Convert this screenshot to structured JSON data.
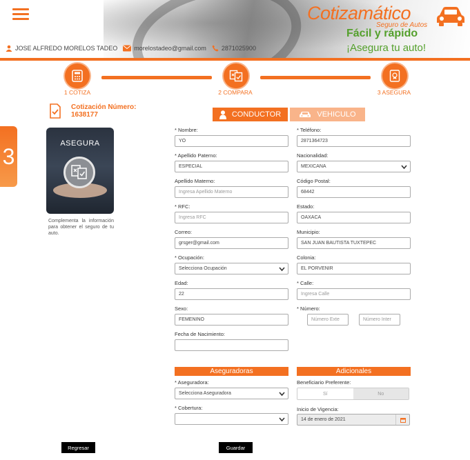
{
  "header": {
    "brand_title": "Cotizamático",
    "brand_subtitle": "Seguro de Autos",
    "slogan_primary": "Fácil y rápido",
    "slogan_secondary": "¡Asegura tu auto!",
    "user_name": "JOSE ALFREDO MORELOS TADEO",
    "user_email": "morelostadeo@gmail.com",
    "user_phone": "2871025900"
  },
  "steps": [
    {
      "label": "1 COTIZA",
      "icon": "calculator-icon"
    },
    {
      "label": "2 COMPARA",
      "icon": "compare-documents-icon"
    },
    {
      "label": "3 ASEGURA",
      "icon": "certificate-icon"
    }
  ],
  "sidebar": {
    "step_number": "3",
    "quote_label": "Cotización Número:",
    "quote_number": "1638177",
    "card_title": "ASEGURA",
    "card_text": "Complementa la información para obtener el seguro de tu auto."
  },
  "tabs": {
    "conductor": "CONDUCTOR",
    "vehiculo": "VEHICULO"
  },
  "form": {
    "nombre": {
      "label": "* Nombre:",
      "value": "YO"
    },
    "telefono": {
      "label": "* Teléfono:",
      "value": "2871364723"
    },
    "apellido_paterno": {
      "label": "* Apellido Paterno:",
      "value": "ESPECIAL"
    },
    "nacionalidad": {
      "label": "Nacionalidad:",
      "value": "MEXICANA"
    },
    "apellido_materno": {
      "label": "Apellido Materno:",
      "placeholder": "Ingresa Apellido Materno"
    },
    "codigo_postal": {
      "label": "Código Postal:",
      "value": "68442"
    },
    "rfc": {
      "label": "* RFC:",
      "placeholder": "Ingresa RFC"
    },
    "estado": {
      "label": "Estado:",
      "value": "OAXACA"
    },
    "correo": {
      "label": "Correo:",
      "value": "grsger@gmail.com"
    },
    "municipio": {
      "label": "Municipio:",
      "value": "SAN JUAN BAUTISTA TUXTEPEC"
    },
    "ocupacion": {
      "label": "* Ocupación:",
      "placeholder": "Selecciona Ocupación"
    },
    "colonia": {
      "label": "Colonia:",
      "value": "EL PORVENIR"
    },
    "edad": {
      "label": "Edad:",
      "value": "22"
    },
    "calle": {
      "label": "* Calle:",
      "placeholder": "Ingresa Calle"
    },
    "sexo": {
      "label": "Sexo:",
      "value": "FEMENINO"
    },
    "numero": {
      "label": "* Número:",
      "ext_placeholder": "Número Exte",
      "int_placeholder": "Número Inter"
    },
    "fecha_nacimiento": {
      "label": "Fecha de Nacimiento:",
      "value": ""
    }
  },
  "aseguradoras": {
    "heading": "Aseguradoras",
    "aseguradora_label": "* Aseguradora:",
    "aseguradora_placeholder": "Selecciona Aseguradora",
    "cobertura_label": "* Cobertura:",
    "cobertura_value": ""
  },
  "adicionales": {
    "heading": "Adicionales",
    "beneficiario_label": "Beneficiario Preferente:",
    "si": "Sí",
    "no": "No",
    "vigencia_label": "Inicio de Vigencia:",
    "vigencia_value": "14 de enero de 2021"
  },
  "actions": {
    "back": "Regresar",
    "save": "Guardar"
  },
  "colors": {
    "accent": "#f37021",
    "accent_light": "#f9b48a",
    "slogan_green": "#54a02c"
  }
}
